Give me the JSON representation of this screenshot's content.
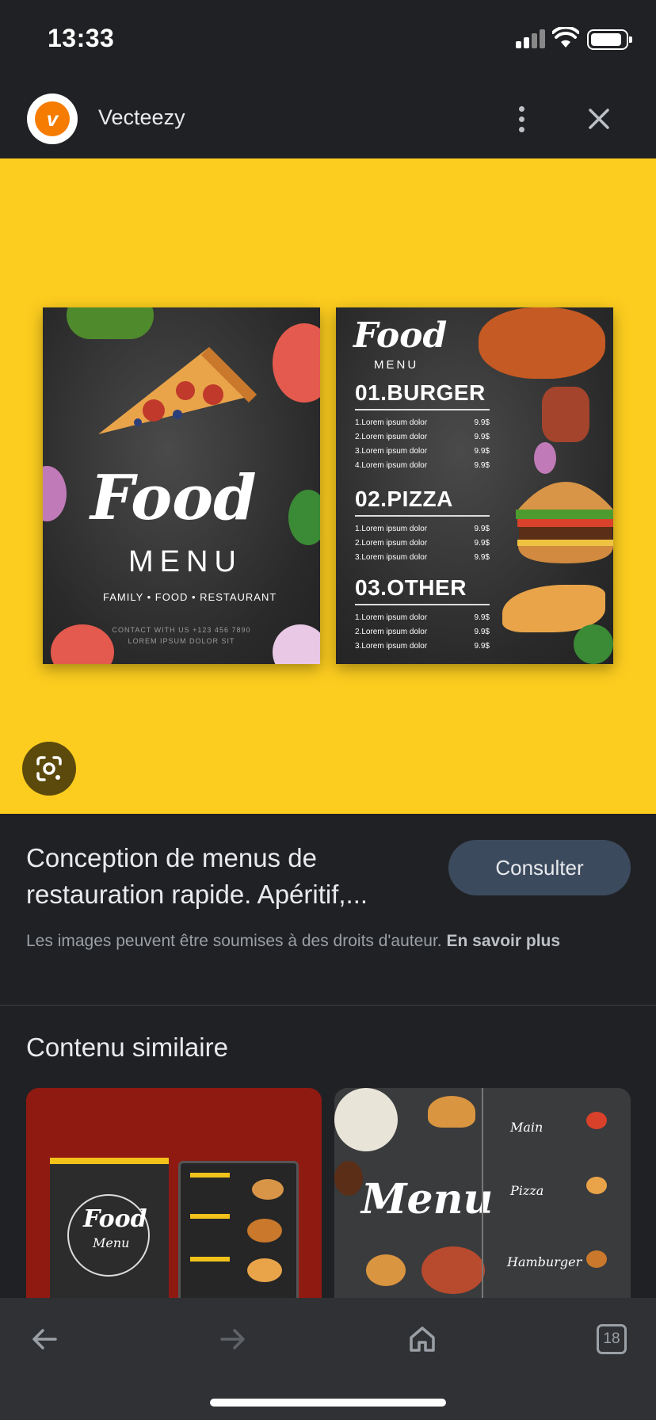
{
  "status_bar": {
    "time": "13:33"
  },
  "source": {
    "name": "Vecteezy"
  },
  "image": {
    "poster_left": {
      "headline": "Food",
      "subheadline": "MENU",
      "tagline": "FAMILY • FOOD • RESTAURANT",
      "contact_line1": "CONTACT WITH US +123 456 7890",
      "contact_line2": "LOREM IPSUM DOLOR SIT"
    },
    "poster_right": {
      "headline": "Food",
      "subheadline": "MENU",
      "sections": [
        {
          "title": "01.BURGER",
          "items": [
            {
              "name": "1.Lorem ipsum dolor",
              "price": "9.9$"
            },
            {
              "name": "2.Lorem ipsum dolor",
              "price": "9.9$"
            },
            {
              "name": "3.Lorem ipsum dolor",
              "price": "9.9$"
            },
            {
              "name": "4.Lorem ipsum dolor",
              "price": "9.9$"
            }
          ]
        },
        {
          "title": "02.PIZZA",
          "items": [
            {
              "name": "1.Lorem ipsum dolor",
              "price": "9.9$"
            },
            {
              "name": "2.Lorem ipsum dolor",
              "price": "9.9$"
            },
            {
              "name": "3.Lorem ipsum dolor",
              "price": "9.9$"
            }
          ]
        },
        {
          "title": "03.OTHER",
          "items": [
            {
              "name": "1.Lorem ipsum dolor",
              "price": "9.9$"
            },
            {
              "name": "2.Lorem ipsum dolor",
              "price": "9.9$"
            },
            {
              "name": "3.Lorem ipsum dolor",
              "price": "9.9$"
            }
          ]
        }
      ]
    }
  },
  "info": {
    "title": "Conception de menus de restauration rapide. Apéritif,...",
    "consult_label": "Consulter",
    "copyright_text": "Les images peuvent être soumises à des droits d'auteur.",
    "learn_more": "En savoir plus"
  },
  "similar": {
    "heading": "Contenu similaire",
    "thumb1": {
      "headline": "Food",
      "sub": "Menu"
    },
    "thumb2": {
      "headline": "Menu",
      "sections": [
        "Main",
        "Pizza",
        "Hamburger"
      ]
    }
  },
  "toolbar": {
    "tab_count": "18"
  },
  "colors": {
    "background": "#202124",
    "image_bg": "#fccd1f",
    "button_bg": "#3c4a5e",
    "toolbar_bg": "#303134",
    "logo_orange": "#f57c00"
  }
}
